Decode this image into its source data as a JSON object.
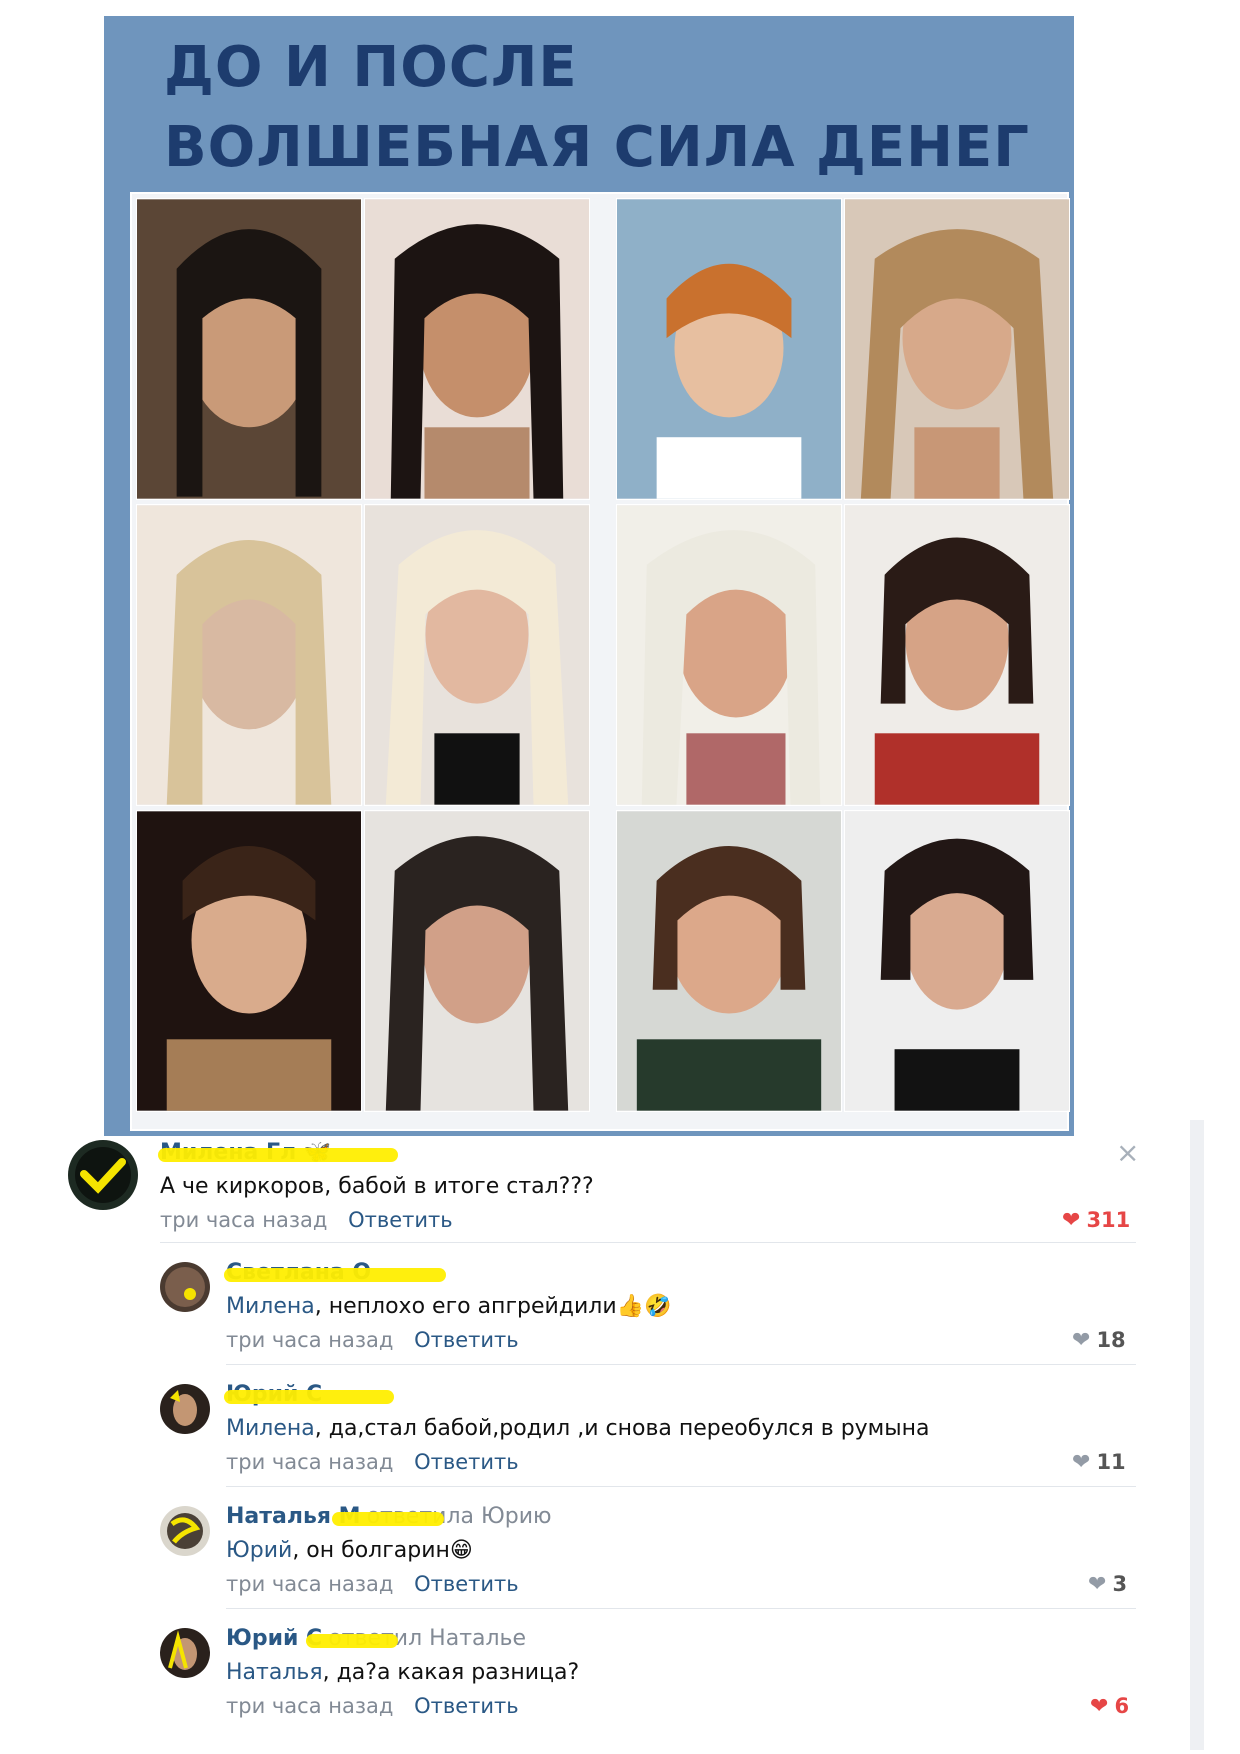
{
  "post_image": {
    "title_line1": "ДО И ПОСЛЕ",
    "title_line2": "ВОЛШЕБНАЯ СИЛА ДЕНЕГ",
    "background": "#6f95bd",
    "title_color": "#1d3c6e"
  },
  "comments": [
    {
      "author": "Милена Гл",
      "author_icon": "butterfly-emoji",
      "text": "А че киркоров, бабой в итоге стал???",
      "time": "три часа назад",
      "reply": "Ответить",
      "likes": "311",
      "liked": true
    },
    {
      "author": "Светлана О",
      "mention": "Милена",
      "text": ", неплохо его апгрейдили",
      "emoji": "👍🤣",
      "time": "три часа назад",
      "reply": "Ответить",
      "likes": "18",
      "liked": false
    },
    {
      "author": "Юрий С",
      "mention": "Милена",
      "text": ", да,стал бабой,родил ,и снова переобулся в румына",
      "time": "три часа назад",
      "reply": "Ответить",
      "likes": "11",
      "liked": false
    },
    {
      "author": "Наталья М",
      "reply_note": "ответила Юрию",
      "mention": "Юрий",
      "text": ", он болгарин",
      "emoji": "😁",
      "time": "три часа назад",
      "reply": "Ответить",
      "likes": "3",
      "liked": false
    },
    {
      "author": "Юрий С",
      "reply_note": "ответил Наталье",
      "mention": "Наталья",
      "text": ", да?а какая разница?",
      "time": "три часа назад",
      "reply": "Ответить",
      "likes": "6",
      "liked": true
    }
  ],
  "close_icon": "×",
  "colors": {
    "link": "#2a5885",
    "meta": "#828a95",
    "liked_heart": "#e64646",
    "scribble": "#ffee00"
  }
}
